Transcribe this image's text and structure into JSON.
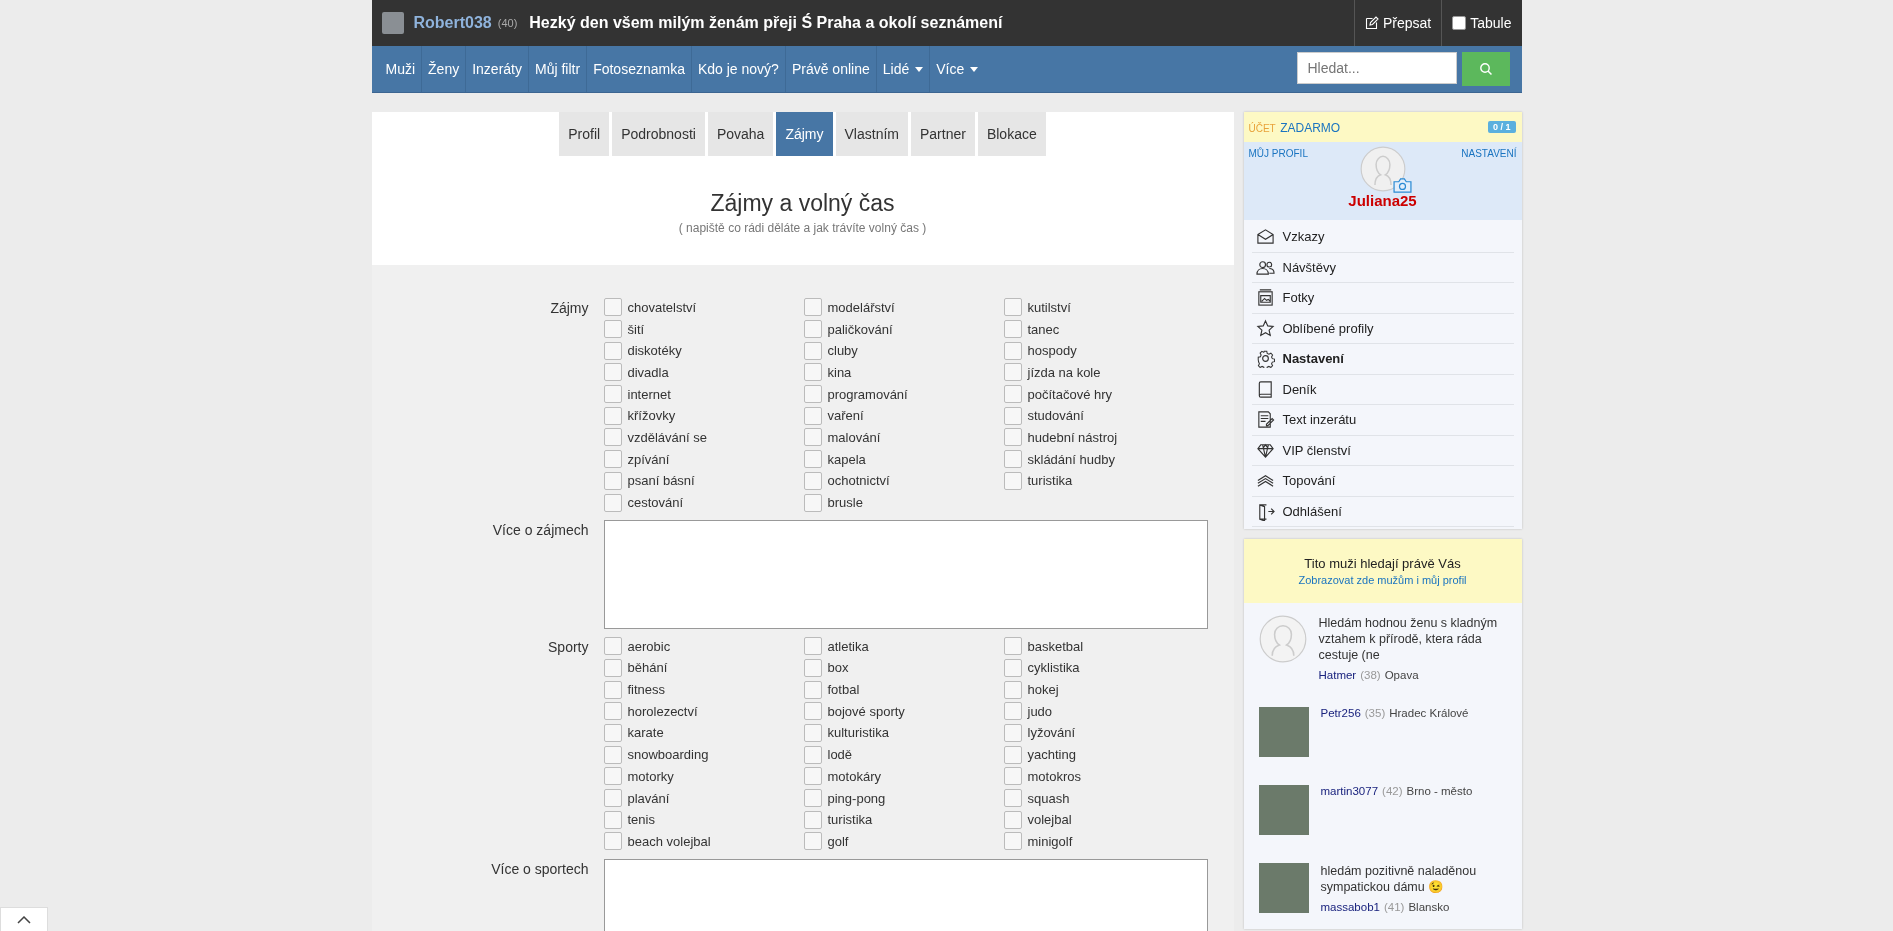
{
  "top_bar": {
    "user": {
      "name": "Robert038",
      "age": "(40)"
    },
    "status": "Hezký den všem milým ženám přeji Ś Praha a okolí seznámení",
    "actions": [
      {
        "kind": "edit",
        "label": "Přepsat"
      },
      {
        "kind": "checkbox",
        "label": "Tabule",
        "checked": false
      }
    ]
  },
  "nav": {
    "items": [
      {
        "label": "Muži",
        "dropdown": false
      },
      {
        "label": "Ženy",
        "dropdown": false
      },
      {
        "label": "Inzeráty",
        "dropdown": false
      },
      {
        "label": "Můj filtr",
        "dropdown": false
      },
      {
        "label": "Fotoseznamka",
        "dropdown": false
      },
      {
        "label": "Kdo je nový?",
        "dropdown": false
      },
      {
        "label": "Právě online",
        "dropdown": false
      },
      {
        "label": "Lidé",
        "dropdown": true
      },
      {
        "label": "Více",
        "dropdown": true
      }
    ],
    "search": {
      "placeholder": "Hledat..."
    }
  },
  "tabs": [
    {
      "label": "Profil",
      "selected": false
    },
    {
      "label": "Podrobnosti",
      "selected": false
    },
    {
      "label": "Povaha",
      "selected": false
    },
    {
      "label": "Zájmy",
      "selected": true
    },
    {
      "label": "Vlastním",
      "selected": false
    },
    {
      "label": "Partner",
      "selected": false
    },
    {
      "label": "Blokace",
      "selected": false
    }
  ],
  "section": {
    "title": "Zájmy a volný čas",
    "subtitle": "( napiště co rádi děláte a jak trávíte volný čas )"
  },
  "form": [
    {
      "kind": "checkboxes",
      "label": "Zájmy",
      "options": [
        {
          "label": "chovatelství",
          "checked": false
        },
        {
          "label": "modelářství",
          "checked": false
        },
        {
          "label": "kutilství",
          "checked": false
        },
        {
          "label": "šití",
          "checked": false
        },
        {
          "label": "paličkování",
          "checked": false
        },
        {
          "label": "tanec",
          "checked": false
        },
        {
          "label": "diskotéky",
          "checked": false
        },
        {
          "label": "cluby",
          "checked": false
        },
        {
          "label": "hospody",
          "checked": false
        },
        {
          "label": "divadla",
          "checked": false
        },
        {
          "label": "kina",
          "checked": false
        },
        {
          "label": "jízda na kole",
          "checked": false
        },
        {
          "label": "internet",
          "checked": false
        },
        {
          "label": "programování",
          "checked": false
        },
        {
          "label": "počítačové hry",
          "checked": false
        },
        {
          "label": "křížovky",
          "checked": false
        },
        {
          "label": "vaření",
          "checked": false
        },
        {
          "label": "studování",
          "checked": false
        },
        {
          "label": "vzdělávání se",
          "checked": false
        },
        {
          "label": "malování",
          "checked": false
        },
        {
          "label": "hudební nástroj",
          "checked": false
        },
        {
          "label": "zpívání",
          "checked": false
        },
        {
          "label": "kapela",
          "checked": false
        },
        {
          "label": "skládání hudby",
          "checked": false
        },
        {
          "label": "psaní básní",
          "checked": false
        },
        {
          "label": "ochotnictví",
          "checked": false
        },
        {
          "label": "turistika",
          "checked": false
        },
        {
          "label": "cestování",
          "checked": false
        },
        {
          "label": "brusle",
          "checked": false
        }
      ]
    },
    {
      "kind": "textarea",
      "label": "Více o zájmech"
    },
    {
      "kind": "checkboxes",
      "label": "Sporty",
      "options": [
        {
          "label": "aerobic",
          "checked": false
        },
        {
          "label": "atletika",
          "checked": false
        },
        {
          "label": "basketbal",
          "checked": false
        },
        {
          "label": "běhání",
          "checked": false
        },
        {
          "label": "box",
          "checked": false
        },
        {
          "label": "cyklistika",
          "checked": false
        },
        {
          "label": "fitness",
          "checked": false
        },
        {
          "label": "fotbal",
          "checked": false
        },
        {
          "label": "hokej",
          "checked": false
        },
        {
          "label": "horolezectví",
          "checked": false
        },
        {
          "label": "bojové sporty",
          "checked": false
        },
        {
          "label": "judo",
          "checked": false
        },
        {
          "label": "karate",
          "checked": false
        },
        {
          "label": "kulturistika",
          "checked": false
        },
        {
          "label": "lyžování",
          "checked": false
        },
        {
          "label": "snowboarding",
          "checked": false
        },
        {
          "label": "lodě",
          "checked": false
        },
        {
          "label": "yachting",
          "checked": false
        },
        {
          "label": "motorky",
          "checked": false
        },
        {
          "label": "motokáry",
          "checked": false
        },
        {
          "label": "motokros",
          "checked": false
        },
        {
          "label": "plavání",
          "checked": false
        },
        {
          "label": "ping-pong",
          "checked": false
        },
        {
          "label": "squash",
          "checked": false
        },
        {
          "label": "tenis",
          "checked": false
        },
        {
          "label": "turistika",
          "checked": false
        },
        {
          "label": "volejbal",
          "checked": false
        },
        {
          "label": "beach volejbal",
          "checked": false
        },
        {
          "label": "golf",
          "checked": false
        },
        {
          "label": "minigolf",
          "checked": false
        }
      ]
    },
    {
      "kind": "textarea",
      "label": "Více o sportech"
    }
  ],
  "sidebar": {
    "account": {
      "label": "ÚČET",
      "plan": "ZADARMO",
      "badge": "0 / 1"
    },
    "profile": {
      "left_link": "MŮJ PROFIL",
      "right_link": "NASTAVENÍ",
      "name": "Juliana25"
    },
    "menu": [
      {
        "label": "Vzkazy",
        "selected": false
      },
      {
        "label": "Návštěvy",
        "selected": false
      },
      {
        "label": "Fotky",
        "selected": false
      },
      {
        "label": "Oblíbené profily",
        "selected": false
      },
      {
        "label": "Nastavení",
        "selected": true
      },
      {
        "label": "Deník",
        "selected": false
      },
      {
        "label": "Text inzerátu",
        "selected": false
      },
      {
        "label": "VIP členství",
        "selected": false
      },
      {
        "label": "Topování",
        "selected": false
      },
      {
        "label": "Odhlášení",
        "selected": false
      }
    ],
    "suggestions": {
      "title": "Tito muži hledají právě Vás",
      "link": "Zobrazovat zde mužům i můj profil",
      "profiles": [
        {
          "kind": "silhouette",
          "text": "Hledám hodnou ženu s kladným vztahem k přírodě, ktera ráda cestuje (ne",
          "name": "Hatmer",
          "age": "(38)",
          "city": "Opava"
        },
        {
          "kind": "photo",
          "name": "Petr256",
          "age": "(35)",
          "city": "Hradec Králové"
        },
        {
          "kind": "photo",
          "name": "martin3077",
          "age": "(42)",
          "city": "Brno - město"
        },
        {
          "kind": "photo",
          "text": "hledám pozitivně naladěnou sympatickou dámu 😉",
          "name": "massabob1",
          "age": "(41)",
          "city": "Blansko"
        }
      ]
    }
  }
}
